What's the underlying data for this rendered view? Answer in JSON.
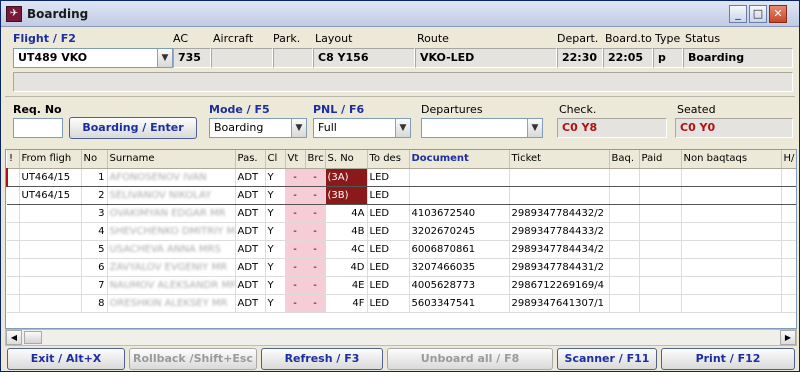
{
  "window": {
    "title": "Boarding",
    "icon": "airport-app-icon"
  },
  "flight_row": {
    "flight_label": "Flight / F2",
    "flight_value": "UT489 VKO",
    "ac_label": "AC",
    "ac_value": "735",
    "aircraft_label": "Aircraft",
    "aircraft_value": "",
    "park_label": "Park.",
    "park_value": "",
    "layout_label": "Layout",
    "layout_value": "C8 Y156",
    "route_label": "Route",
    "route_value": "VKO-LED",
    "depart_label": "Depart.",
    "depart_value": "22:30",
    "boardto_label": "Board.to",
    "boardto_value": "22:05",
    "type_label": "Type",
    "type_value": "p",
    "status_label": "Status",
    "status_value": "Boarding"
  },
  "controls": {
    "reqno_label": "Req. No",
    "reqno_value": "",
    "boarding_enter_label": "Boarding / Enter",
    "mode_label": "Mode / F5",
    "mode_value": "Boarding",
    "pnl_label": "PNL / F6",
    "pnl_value": "Full",
    "departures_label": "Departures",
    "departures_value": "",
    "check_label": "Check.",
    "check_value": "C0 Y8",
    "seated_label": "Seated",
    "seated_value": "C0 Y0"
  },
  "table": {
    "columns": [
      "!",
      "From fligh",
      "No",
      "Surname",
      "Pas.",
      "Cl",
      "Vt",
      "Brc",
      "S. No",
      "To des",
      "Document",
      "Ticket",
      "Baq.",
      "Paid",
      "Non baqtaqs",
      "H/"
    ],
    "rows": [
      {
        "from": "UT464/15",
        "no": "1",
        "surname": "AFONOSENOV IVAN",
        "pas": "ADT",
        "cl": "Y",
        "vt": "-",
        "brc": "-",
        "seat": "(3A)",
        "dest": "LED",
        "document": "",
        "ticket": ""
      },
      {
        "from": "UT464/15",
        "no": "2",
        "surname": "SELIVANOV NIKOLAY",
        "pas": "ADT",
        "cl": "Y",
        "vt": "-",
        "brc": "-",
        "seat": "(3B)",
        "dest": "LED",
        "document": "",
        "ticket": ""
      },
      {
        "from": "",
        "no": "3",
        "surname": "OVAKIMYAN EDGAR MR",
        "pas": "ADT",
        "cl": "Y",
        "vt": "-",
        "brc": "-",
        "seat": "4A",
        "dest": "LED",
        "document": "4103672540",
        "ticket": "2989347784432/2"
      },
      {
        "from": "",
        "no": "4",
        "surname": "SHEVCHENKO DMITRIY MR",
        "pas": "ADT",
        "cl": "Y",
        "vt": "-",
        "brc": "-",
        "seat": "4B",
        "dest": "LED",
        "document": "3202670245",
        "ticket": "2989347784433/2"
      },
      {
        "from": "",
        "no": "5",
        "surname": "USACHEVA ANNA MRS",
        "pas": "ADT",
        "cl": "Y",
        "vt": "-",
        "brc": "-",
        "seat": "4C",
        "dest": "LED",
        "document": "6006870861",
        "ticket": "2989347784434/2"
      },
      {
        "from": "",
        "no": "6",
        "surname": "ZAVYALOV EVGENIY MR",
        "pas": "ADT",
        "cl": "Y",
        "vt": "-",
        "brc": "-",
        "seat": "4D",
        "dest": "LED",
        "document": "3207466035",
        "ticket": "2989347784431/2"
      },
      {
        "from": "",
        "no": "7",
        "surname": "NAUMOV ALEKSANDR MR",
        "pas": "ADT",
        "cl": "Y",
        "vt": "-",
        "brc": "-",
        "seat": "4E",
        "dest": "LED",
        "document": "4005628773",
        "ticket": "2986712269169/4"
      },
      {
        "from": "",
        "no": "8",
        "surname": "ORESHKIN ALEKSEY MR",
        "pas": "ADT",
        "cl": "Y",
        "vt": "-",
        "brc": "-",
        "seat": "4F",
        "dest": "LED",
        "document": "5603347541",
        "ticket": "2989347641307/1"
      }
    ]
  },
  "footer": {
    "exit_label": "Exit / Alt+X",
    "rollback_label": "Rollback /Shift+Esc",
    "refresh_label": "Refresh / F3",
    "unboard_label": "Unboard all / F8",
    "scanner_label": "Scanner / F11",
    "print_label": "Print / F12"
  },
  "colors": {
    "accent": "#1c2ea0",
    "seat_selected": "#8a1a1a",
    "pink_cell": "#f6cdd6",
    "status_red": "#b01010"
  }
}
